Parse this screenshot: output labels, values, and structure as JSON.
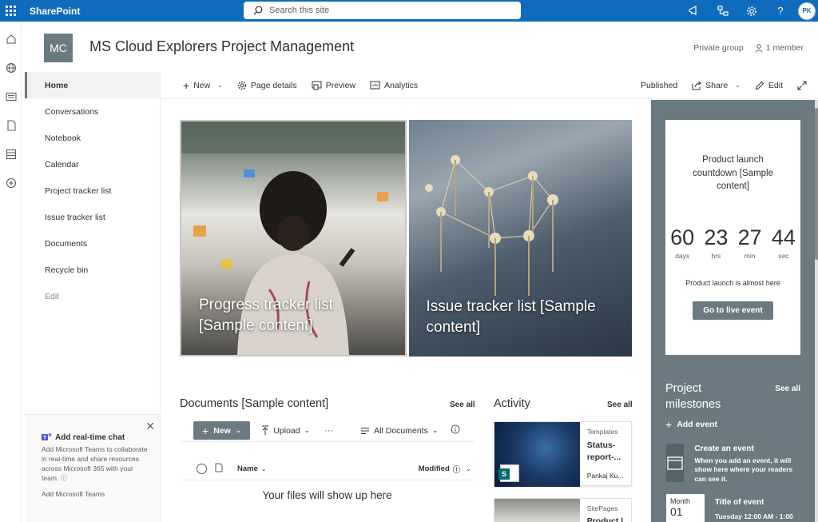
{
  "suite": {
    "brand": "SharePoint",
    "search_placeholder": "Search this site",
    "user_initials": "PK"
  },
  "site": {
    "logo_initials": "MC",
    "title": "MS Cloud Explorers Project Management",
    "privacy": "Private group",
    "members": "1 member"
  },
  "nav": {
    "items": [
      {
        "label": "Home"
      },
      {
        "label": "Conversations"
      },
      {
        "label": "Notebook"
      },
      {
        "label": "Calendar"
      },
      {
        "label": "Project tracker list"
      },
      {
        "label": "Issue tracker list"
      },
      {
        "label": "Documents"
      },
      {
        "label": "Recycle bin"
      }
    ],
    "edit_label": "Edit"
  },
  "chat_card": {
    "title": "Add real-time chat",
    "body": "Add Microsoft Teams to collaborate in real-time and share resources across Microsoft 365 with your team.",
    "link": "Add Microsoft Teams"
  },
  "commands": {
    "new": "New",
    "page_details": "Page details",
    "preview": "Preview",
    "analytics": "Analytics",
    "status": "Published",
    "share": "Share",
    "edit": "Edit"
  },
  "hero": {
    "tiles": [
      {
        "title": "Progress tracker list [Sample content]"
      },
      {
        "title": "Issue tracker list [Sample content]"
      }
    ]
  },
  "countdown": {
    "title": "Product launch countdown [Sample content]",
    "units": [
      {
        "value": "60",
        "label": "days"
      },
      {
        "value": "23",
        "label": "hrs"
      },
      {
        "value": "27",
        "label": "min"
      },
      {
        "value": "44",
        "label": "sec"
      }
    ],
    "message": "Product launch is almost here",
    "button": "Go to live event"
  },
  "milestones": {
    "title": "Project milestones",
    "see_all": "See all",
    "add_event": "Add event",
    "create_title": "Create an event",
    "create_desc": "When you add an event, it will show here where your readers can see it.",
    "date_month": "Month",
    "date_day": "01",
    "event_title": "Title of event",
    "event_time": "Tuesday 12:00 AM - 1:00"
  },
  "documents": {
    "title": "Documents [Sample content]",
    "see_all": "See all",
    "new": "New",
    "upload": "Upload",
    "more": "···",
    "view": "All Documents",
    "col_name": "Name",
    "col_modified": "Modified",
    "empty": "Your files will show up here"
  },
  "activity": {
    "title": "Activity",
    "see_all": "See all",
    "card1": {
      "type": "Templates",
      "name": "Status-report-...",
      "author": "Pankaj Ku..."
    },
    "card2": {
      "type": "SitePages",
      "name": "Product l..."
    }
  },
  "colors": {
    "suite_blue": "#0f6cbd",
    "theme_slate": "#6b7a80"
  }
}
